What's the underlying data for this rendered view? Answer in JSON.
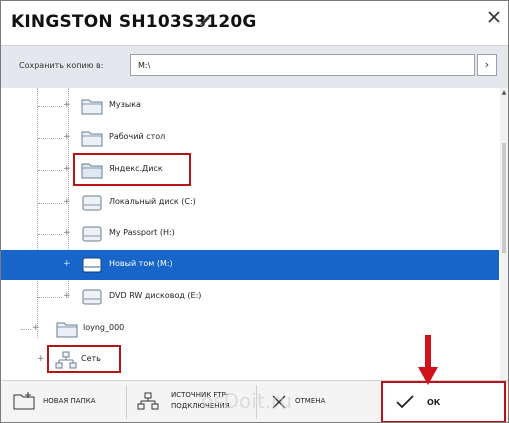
{
  "window": {
    "title": "KINGSTON SH103S3120G",
    "edit_icon": "pencil-icon",
    "close_icon": "close-icon"
  },
  "path_bar": {
    "label": "Сохранить копию в:",
    "value": "M:\\",
    "go_icon": "chevron-right-icon"
  },
  "tree": {
    "items": [
      {
        "label": "Музыка",
        "icon": "folder-icon",
        "selected": false,
        "highlighted": false
      },
      {
        "label": "Рабочий стол",
        "icon": "folder-icon",
        "selected": false,
        "highlighted": false
      },
      {
        "label": "Яндекс.Диск",
        "icon": "folder-icon",
        "selected": false,
        "highlighted": true
      },
      {
        "label": "Локальный диск (C:)",
        "icon": "drive-icon",
        "selected": false,
        "highlighted": false
      },
      {
        "label": "My Passport (H:)",
        "icon": "drive-icon",
        "selected": false,
        "highlighted": false
      },
      {
        "label": "Новый том (M:)",
        "icon": "drive-icon",
        "selected": true,
        "highlighted": false
      },
      {
        "label": "DVD RW дисковод (E:)",
        "icon": "drive-icon",
        "selected": false,
        "highlighted": false
      },
      {
        "label": "loyng_000",
        "icon": "folder-icon",
        "selected": false,
        "highlighted": false
      },
      {
        "label": "Сеть",
        "icon": "network-icon",
        "selected": false,
        "highlighted": true
      }
    ]
  },
  "toolbar": {
    "new_folder_label": "НОВАЯ ПАПКА",
    "ftp_label_line1": "ИСТОЧНИК FTP-",
    "ftp_label_line2": "ПОДКЛЮЧЕНИЯ",
    "cancel_label": "ОТМЕНА",
    "ok_label": "ОК"
  },
  "watermark": "osDoit.ru",
  "colors": {
    "selection": "#1765c8",
    "highlight_box": "#b7141a",
    "arrow": "#d1121a"
  }
}
